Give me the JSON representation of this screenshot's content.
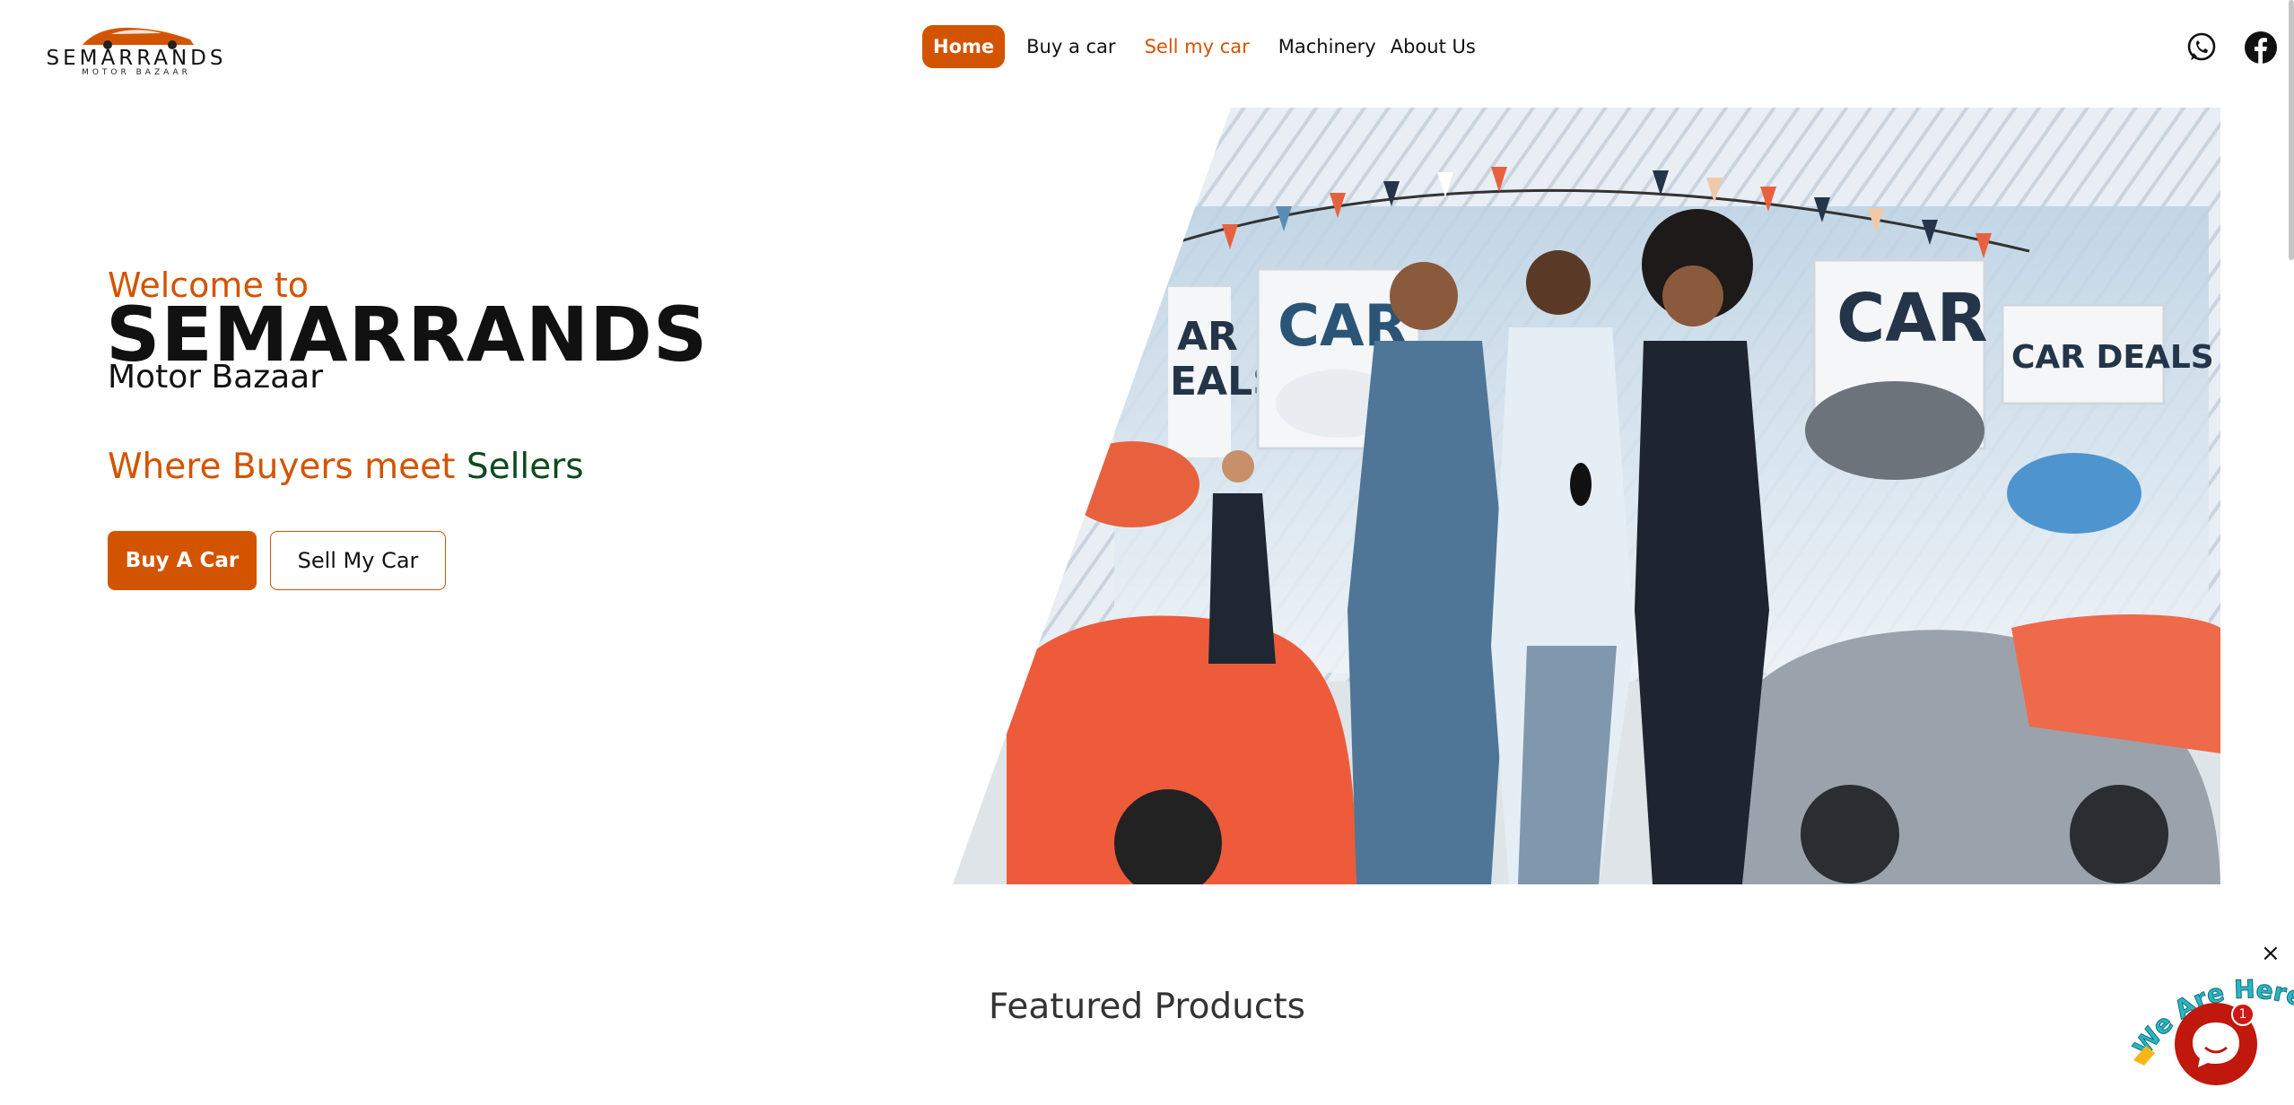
{
  "brand": {
    "wordmark": "SEMARRANDS",
    "sub": "MOTOR BAZAAR",
    "accent": "#d35400",
    "green": "#0d4a1c"
  },
  "nav": {
    "items": [
      {
        "label": "Home",
        "state": "active"
      },
      {
        "label": "Buy a car",
        "state": "normal"
      },
      {
        "label": "Sell my car",
        "state": "highlight"
      },
      {
        "label": "Machinery",
        "state": "normal"
      },
      {
        "label": "About Us",
        "state": "normal"
      }
    ]
  },
  "social": {
    "icons": [
      "whatsapp-icon",
      "facebook-icon"
    ]
  },
  "hero": {
    "welcome": "Welcome to",
    "title": "SEMARRANDS",
    "subtitle": "Motor Bazaar",
    "tagline_part1": "Where Buyers meet ",
    "tagline_part2": "Sellers",
    "buy_button": "Buy A Car",
    "sell_button": "Sell My Car",
    "image_signs": [
      "CAR",
      "CAR",
      "CAR DEALS",
      "AR EALS"
    ]
  },
  "featured": {
    "heading": "Featured Products"
  },
  "chat": {
    "close": "×",
    "badge_count": "1",
    "label": "We Are Here!"
  }
}
